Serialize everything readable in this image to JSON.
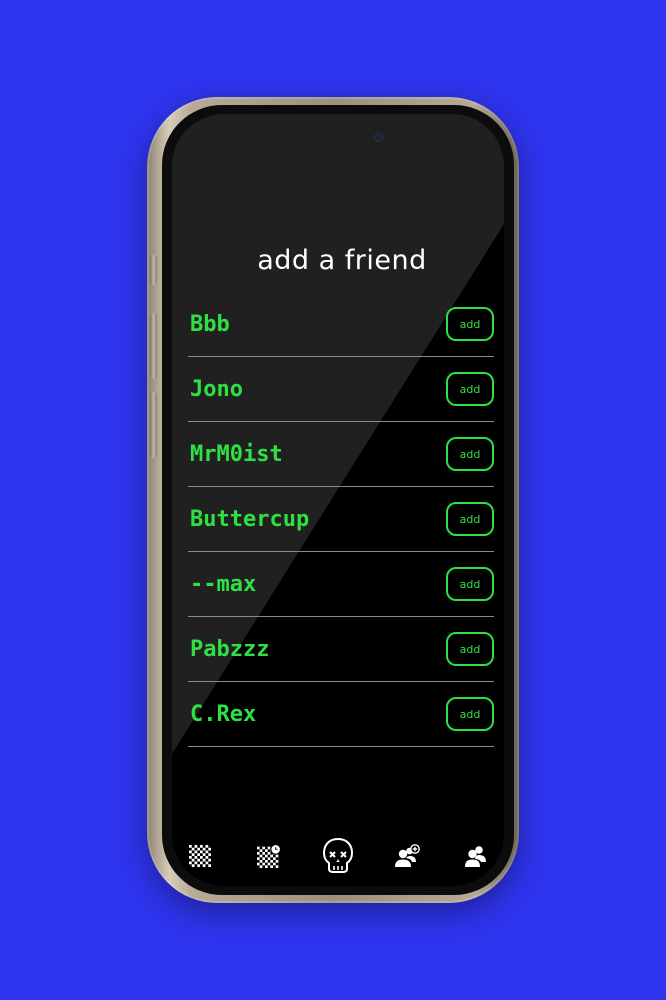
{
  "screen": {
    "title": "add a friend"
  },
  "friends": [
    {
      "name": "Bbb",
      "action_label": "add"
    },
    {
      "name": "Jono",
      "action_label": "add"
    },
    {
      "name": "MrM0ist",
      "action_label": "add"
    },
    {
      "name": "Buttercup",
      "action_label": "add"
    },
    {
      "name": "--max",
      "action_label": "add"
    },
    {
      "name": "Pabzzz",
      "action_label": "add"
    },
    {
      "name": "C.Rex",
      "action_label": "add"
    }
  ],
  "bottom_nav": [
    {
      "icon": "chessboard-icon"
    },
    {
      "icon": "chessboard-clock-icon"
    },
    {
      "icon": "skull-icon"
    },
    {
      "icon": "add-friend-icon"
    },
    {
      "icon": "friends-icon"
    }
  ],
  "colors": {
    "background": "#2f34ee",
    "accent": "#2ee043",
    "screen": "#000000",
    "title": "#ffffff"
  }
}
